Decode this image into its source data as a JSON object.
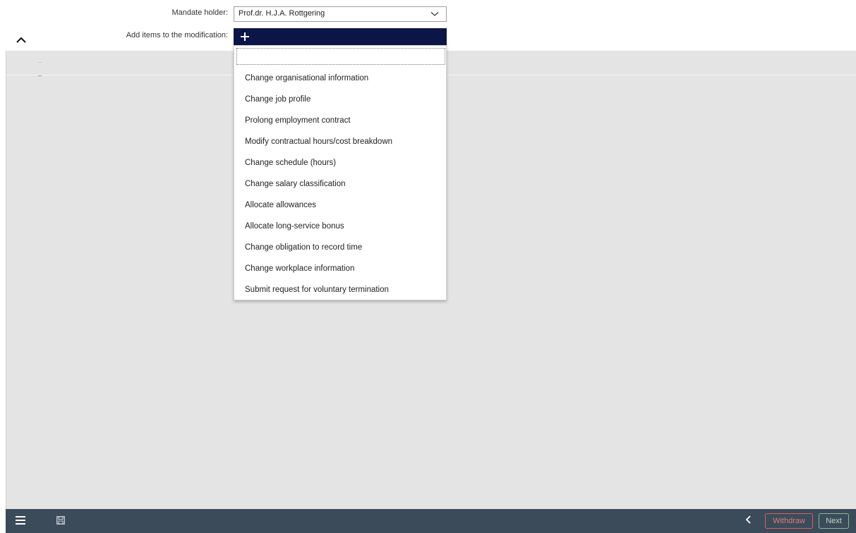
{
  "form": {
    "mandate_holder_label": "Mandate holder:",
    "mandate_holder_value": "Prof.dr. H.J.A. Rottgering",
    "add_items_label": "Add items to the modification:",
    "add_icon": "plus-icon"
  },
  "dropdown": {
    "filter_value": "",
    "options": [
      "Change organisational information",
      "Change job profile",
      "Prolong employment contract",
      "Modify contractual hours/cost breakdown",
      "Change schedule (hours)",
      "Change salary classification",
      "Allocate allowances",
      "Allocate long-service bonus",
      "Change obligation to record time",
      "Change workplace information",
      "Submit request for voluntary termination"
    ]
  },
  "footer": {
    "menu_icon": "hamburger-menu-icon",
    "save_icon": "floppy-disk-icon",
    "back_icon": "chevron-left-icon",
    "withdraw_label": "Withdraw",
    "next_label": "Next"
  },
  "colors": {
    "add_bar": "#0c1548",
    "workspace": "#e4e4e4",
    "footer": "#3c4b5a",
    "withdraw": "#d9605c",
    "next": "#7fbf93"
  }
}
